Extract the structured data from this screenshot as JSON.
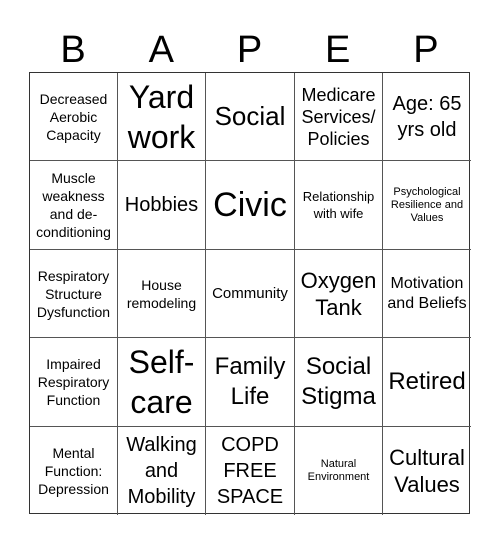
{
  "header": {
    "letters": [
      "B",
      "A",
      "P",
      "E",
      "P"
    ]
  },
  "cells": [
    {
      "text": "Decreased Aerobic Capacity"
    },
    {
      "text": "Yard work"
    },
    {
      "text": "Social"
    },
    {
      "text": "Medicare Services/ Policies"
    },
    {
      "text": "Age: 65 yrs old"
    },
    {
      "text": "Muscle weakness and de-conditioning"
    },
    {
      "text": "Hobbies"
    },
    {
      "text": "Civic"
    },
    {
      "text": "Relationship with wife"
    },
    {
      "text": "Psychological Resilience and Values"
    },
    {
      "text": "Respiratory Structure Dysfunction"
    },
    {
      "text": "House remodeling"
    },
    {
      "text": "Community"
    },
    {
      "text": "Oxygen Tank"
    },
    {
      "text": "Motivation and Beliefs"
    },
    {
      "text": "Impaired Respiratory Function"
    },
    {
      "text": "Self-care"
    },
    {
      "text": "Family Life"
    },
    {
      "text": "Social Stigma"
    },
    {
      "text": "Retired"
    },
    {
      "text": "Mental Function: Depression"
    },
    {
      "text": "Walking and Mobility"
    },
    {
      "text": "COPD FREE SPACE"
    },
    {
      "text": "Natural Environment"
    },
    {
      "text": "Cultural Values"
    }
  ]
}
